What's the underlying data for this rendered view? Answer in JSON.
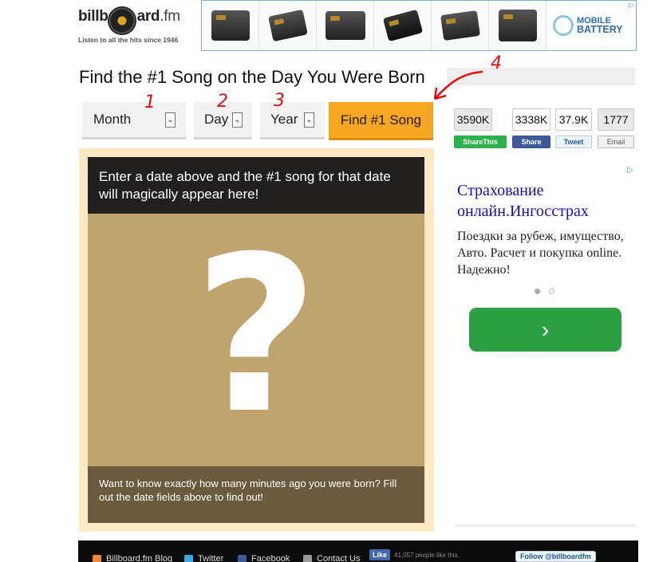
{
  "header": {
    "logo_text_a": "billb",
    "logo_text_b": "ard",
    "logo_text_c": ".fm",
    "tagline": "Listen to all the hits since 1946"
  },
  "ad_banner": {
    "brand_line1": "MOBILE",
    "brand_line2": "BATTERY",
    "adchoice": "▷"
  },
  "page_title": "Find the #1 Song on the Day You Were Born",
  "form": {
    "month_label": "Month",
    "day_label": "Day",
    "year_label": "Year",
    "arrow": "⌄",
    "find_button": "Find #1 Song"
  },
  "annotations": [
    "1",
    "2",
    "3",
    "4"
  ],
  "share": {
    "sharethis_count": "3590K",
    "sharethis_label": "ShareThis",
    "facebook_count": "3338K",
    "facebook_label": "Share",
    "twitter_count": "37.9K",
    "twitter_label": "Tweet",
    "email_count": "1777",
    "email_label": "Email"
  },
  "panel": {
    "heading": "Enter a date above and the #1 song for that date will magically appear here!",
    "question_mark": "?",
    "footer_text": "Want to know exactly how many minutes ago you were born? Fill out the date fields above to find out!"
  },
  "side_ad": {
    "title": "Страхование онлайн.Ингосстрах",
    "text": "Поездки за рубеж, имущество, Авто. Расчет и покупка online. Надежно!",
    "adchoice": "▷",
    "button_glyph": "›"
  },
  "footer": {
    "blog": "Billboard.fm Blog",
    "twitter": "Twitter",
    "facebook": "Facebook",
    "contact": "Contact Us",
    "like_label": "Like",
    "like_count": "41,057 people like this.",
    "follow": "Follow @billboardfm"
  },
  "colors": {
    "find_button": "#f5a623",
    "panel_bg": "#fde8c4",
    "panel_head": "#221f1f",
    "panel_body": "#c0a470",
    "panel_foot": "#6a5a3e",
    "green_button": "#2ea043",
    "annotation_red": "#e01010"
  }
}
